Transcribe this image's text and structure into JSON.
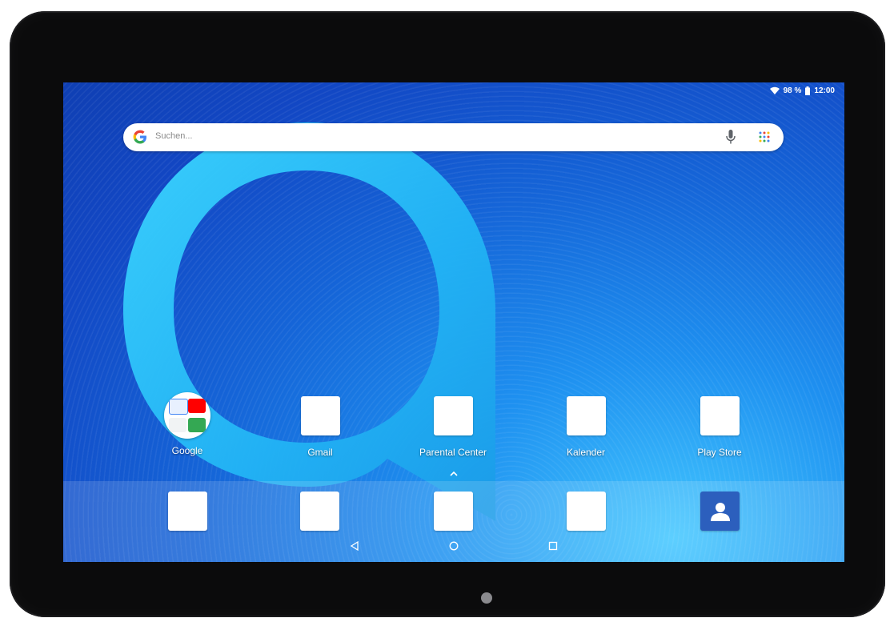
{
  "status_bar": {
    "battery": "98 %",
    "time": "12:00"
  },
  "search": {
    "placeholder": "Suchen..."
  },
  "home_apps": [
    {
      "label": "Google"
    },
    {
      "label": "Gmail"
    },
    {
      "label": "Parental Center"
    },
    {
      "label": "Kalender"
    },
    {
      "label": "Play Store"
    }
  ],
  "icons": {
    "wifi": "wifi-icon",
    "battery": "battery-icon",
    "google": "google-g-icon",
    "mic": "microphone-icon",
    "apps": "app-grid-icon",
    "up": "chevron-up-icon",
    "back": "back-icon",
    "home": "home-icon",
    "recents": "recents-icon",
    "contacts": "contacts-icon"
  },
  "colors": {
    "accent": "#1a73e8",
    "wallpaper": "#1565d8",
    "logo": "#3cc8ff"
  }
}
